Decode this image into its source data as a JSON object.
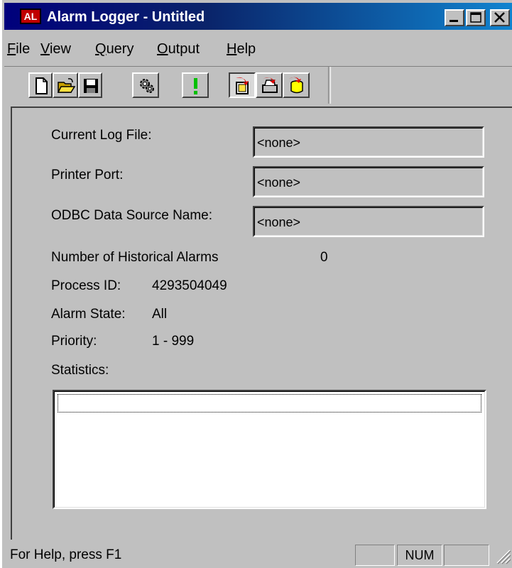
{
  "window": {
    "icon_text": "AL",
    "title": "Alarm Logger - Untitled"
  },
  "menu": [
    {
      "accel": "F",
      "rest": "ile"
    },
    {
      "accel": "V",
      "rest": "iew"
    },
    {
      "accel": "Q",
      "rest": "uery"
    },
    {
      "accel": "O",
      "rest": "utput"
    },
    {
      "accel": "H",
      "rest": "elp"
    }
  ],
  "toolbar": {
    "icons": [
      "new-file-icon",
      "open-folder-icon",
      "save-disk-icon",
      "config-gear-icon",
      "alarm-exclamation-icon",
      "log-to-file-icon",
      "log-to-printer-icon",
      "log-to-database-icon"
    ]
  },
  "form": {
    "log_file_label": "Current Log File:",
    "log_file_value": "<none>",
    "printer_label": "Printer Port:",
    "printer_value": "<none>",
    "odbc_label": "ODBC Data Source Name:",
    "odbc_value": "<none>",
    "hist_alarms_label": "Number of Historical Alarms",
    "hist_alarms_value": "0",
    "process_id_label": "Process ID:",
    "process_id_value": "4293504049",
    "alarm_state_label": "Alarm State:",
    "alarm_state_value": "All",
    "priority_label": "Priority:",
    "priority_value": "1 - 999",
    "statistics_label": "Statistics:"
  },
  "status": {
    "help_text": "For Help, press F1",
    "pane1": "",
    "num": "NUM",
    "pane3": ""
  }
}
